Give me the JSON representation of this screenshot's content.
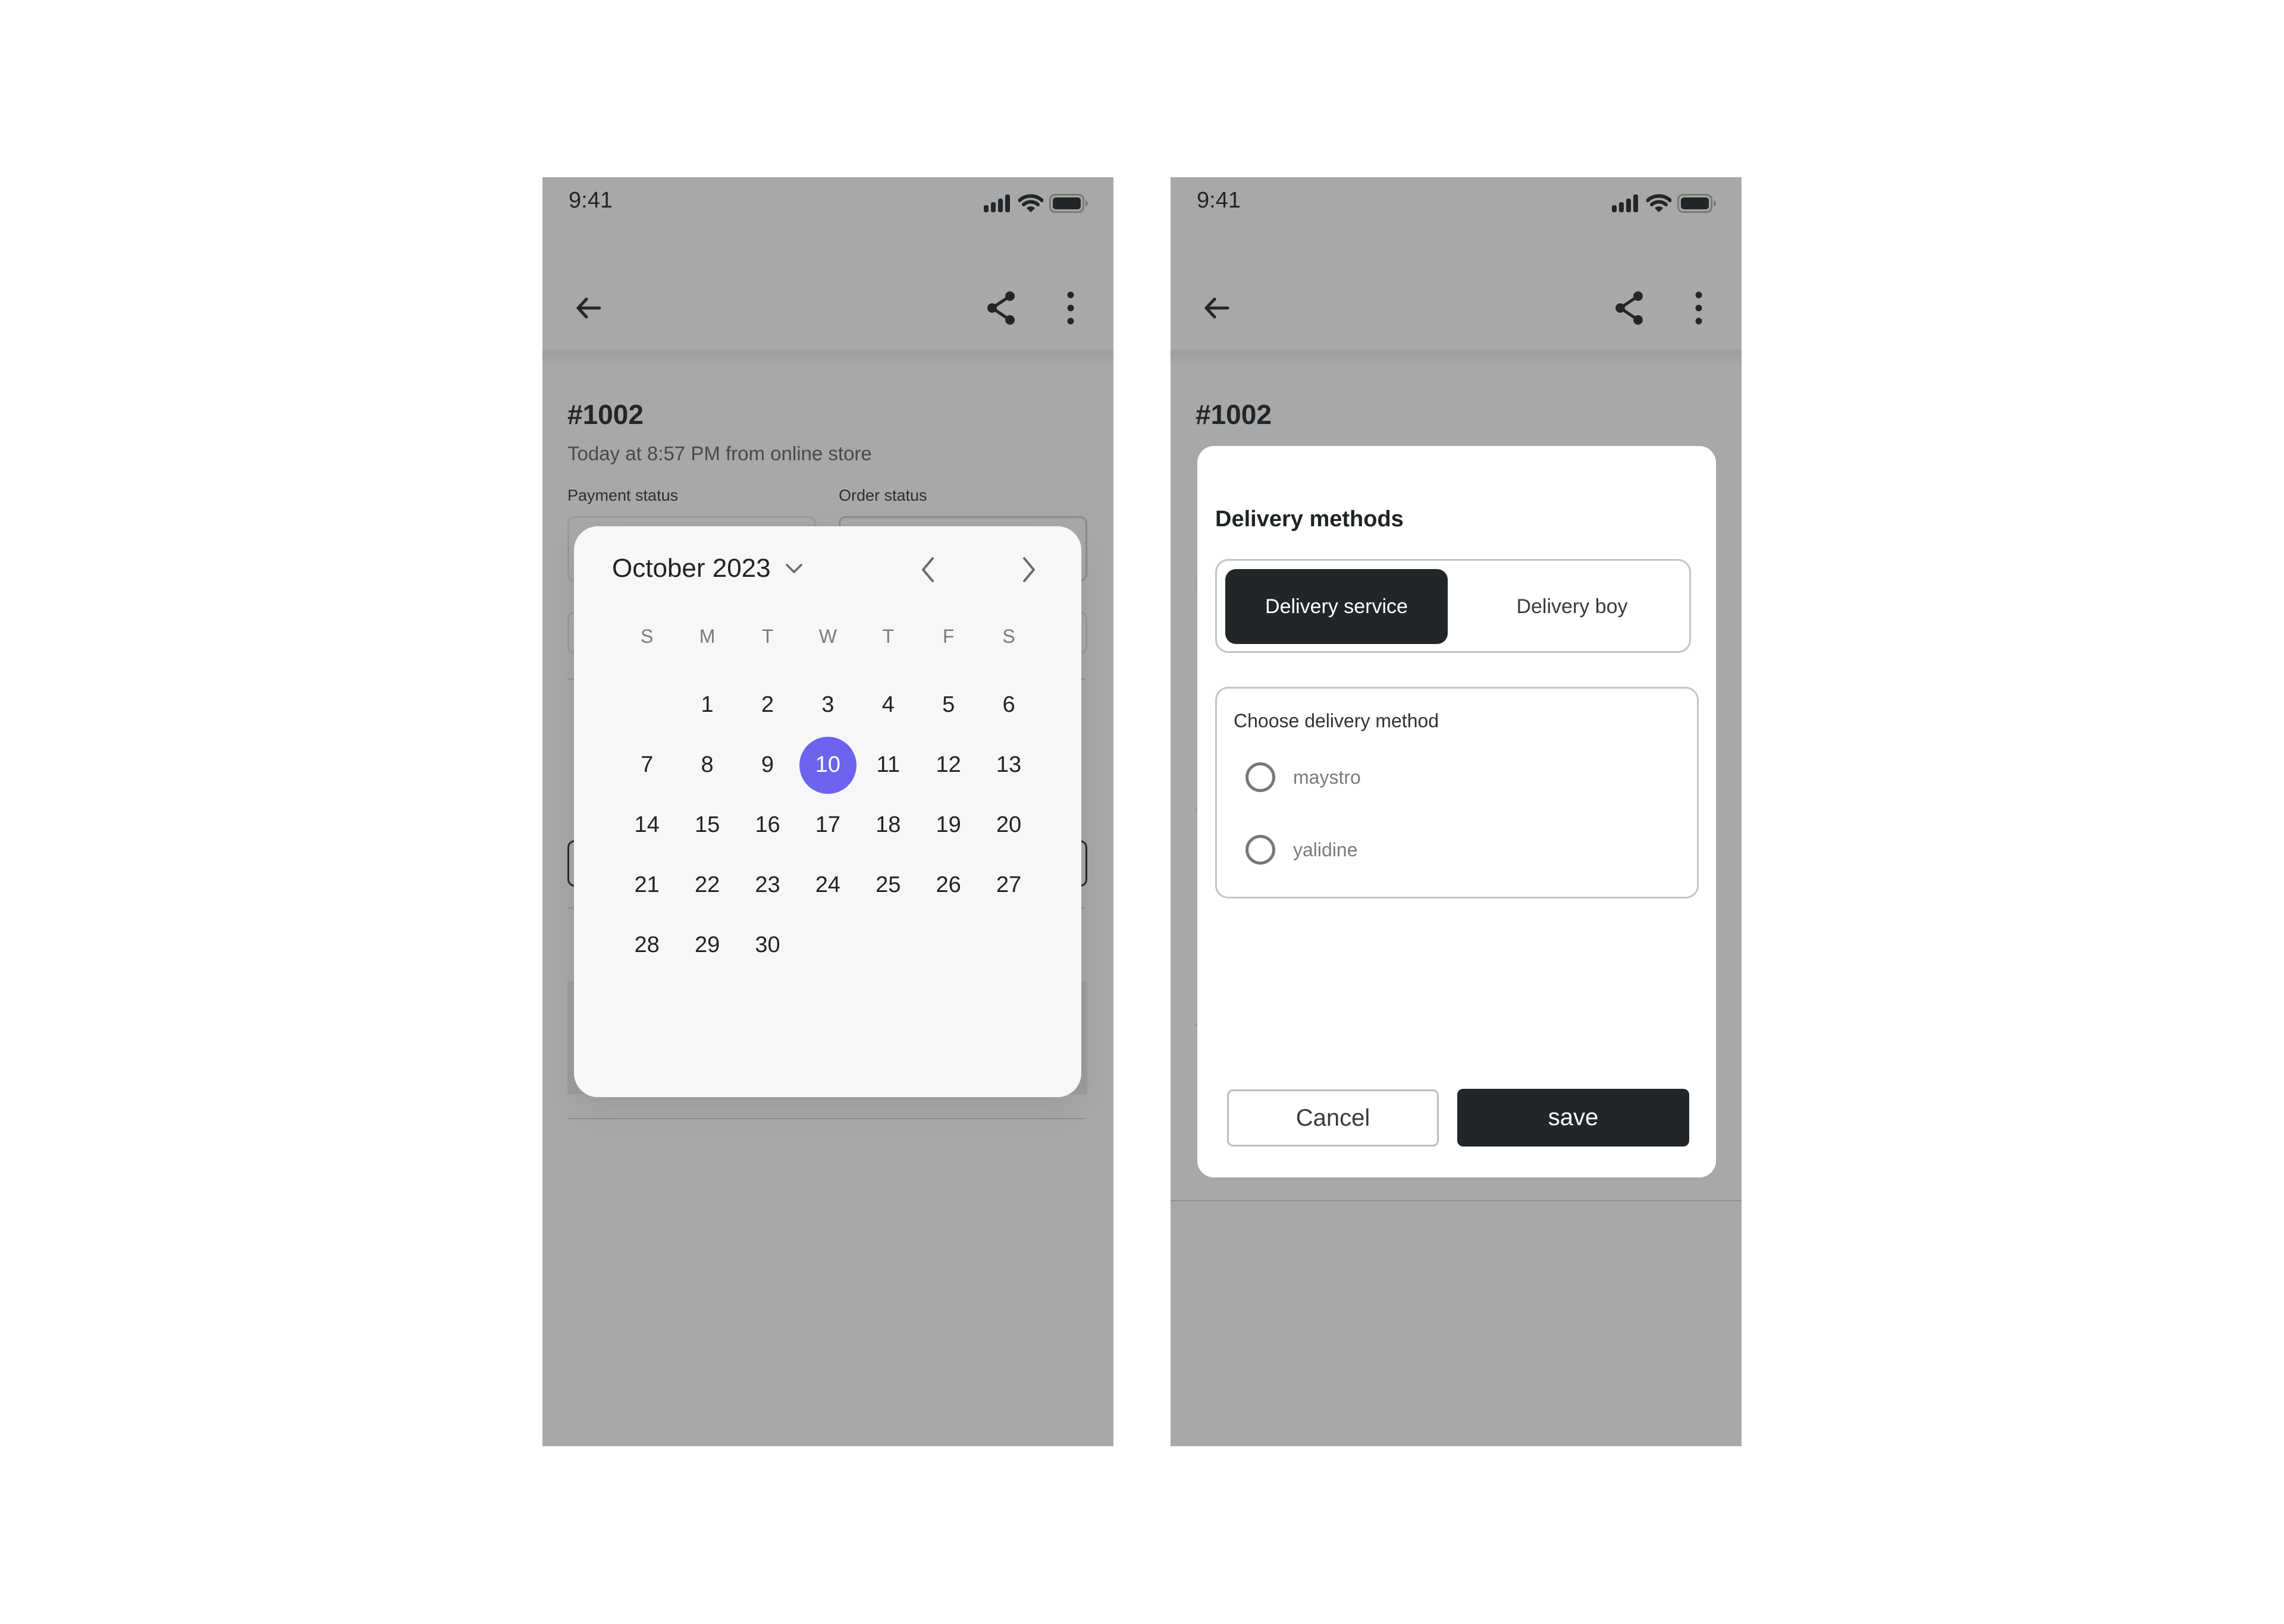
{
  "colors": {
    "overlay_bg": "#a8a8a8",
    "accent": "#6c63ee",
    "dark": "#222629"
  },
  "left_screen": {
    "status_bar": {
      "time": "9:41",
      "icons": [
        "signal-icon",
        "wifi-icon",
        "battery-icon"
      ]
    },
    "nav": {
      "back_icon": "arrow-left-icon",
      "share_icon": "share-icon",
      "more_icon": "more-vertical-icon"
    },
    "order": {
      "title": "#1002",
      "subtitle": "Today at 8:57 PM from online store",
      "payment_status_label": "Payment status",
      "order_status_label": "Order status"
    },
    "calendar": {
      "month_label": "October 2023",
      "weekdays": [
        "S",
        "M",
        "T",
        "W",
        "T",
        "F",
        "S"
      ],
      "leading_blanks": 1,
      "days": [
        "1",
        "2",
        "3",
        "4",
        "5",
        "6",
        "7",
        "8",
        "9",
        "10",
        "11",
        "12",
        "13",
        "14",
        "15",
        "16",
        "17",
        "18",
        "19",
        "20",
        "21",
        "22",
        "23",
        "24",
        "25",
        "26",
        "27",
        "28",
        "29",
        "30"
      ],
      "selected_day": "10"
    }
  },
  "right_screen": {
    "status_bar": {
      "time": "9:41",
      "icons": [
        "signal-icon",
        "wifi-icon",
        "battery-icon"
      ]
    },
    "nav": {
      "back_icon": "arrow-left-icon",
      "share_icon": "share-icon",
      "more_icon": "more-vertical-icon"
    },
    "order": {
      "title": "#1002"
    },
    "modal": {
      "title": "Delivery methods",
      "segments": [
        {
          "label": "Delivery service",
          "active": true
        },
        {
          "label": "Delivery boy",
          "active": false
        }
      ],
      "choose_label": "Choose delivery method",
      "options": [
        {
          "label": "maystro",
          "selected": false
        },
        {
          "label": "yalidine",
          "selected": false
        }
      ],
      "cancel_label": "Cancel",
      "save_label": "save"
    }
  }
}
